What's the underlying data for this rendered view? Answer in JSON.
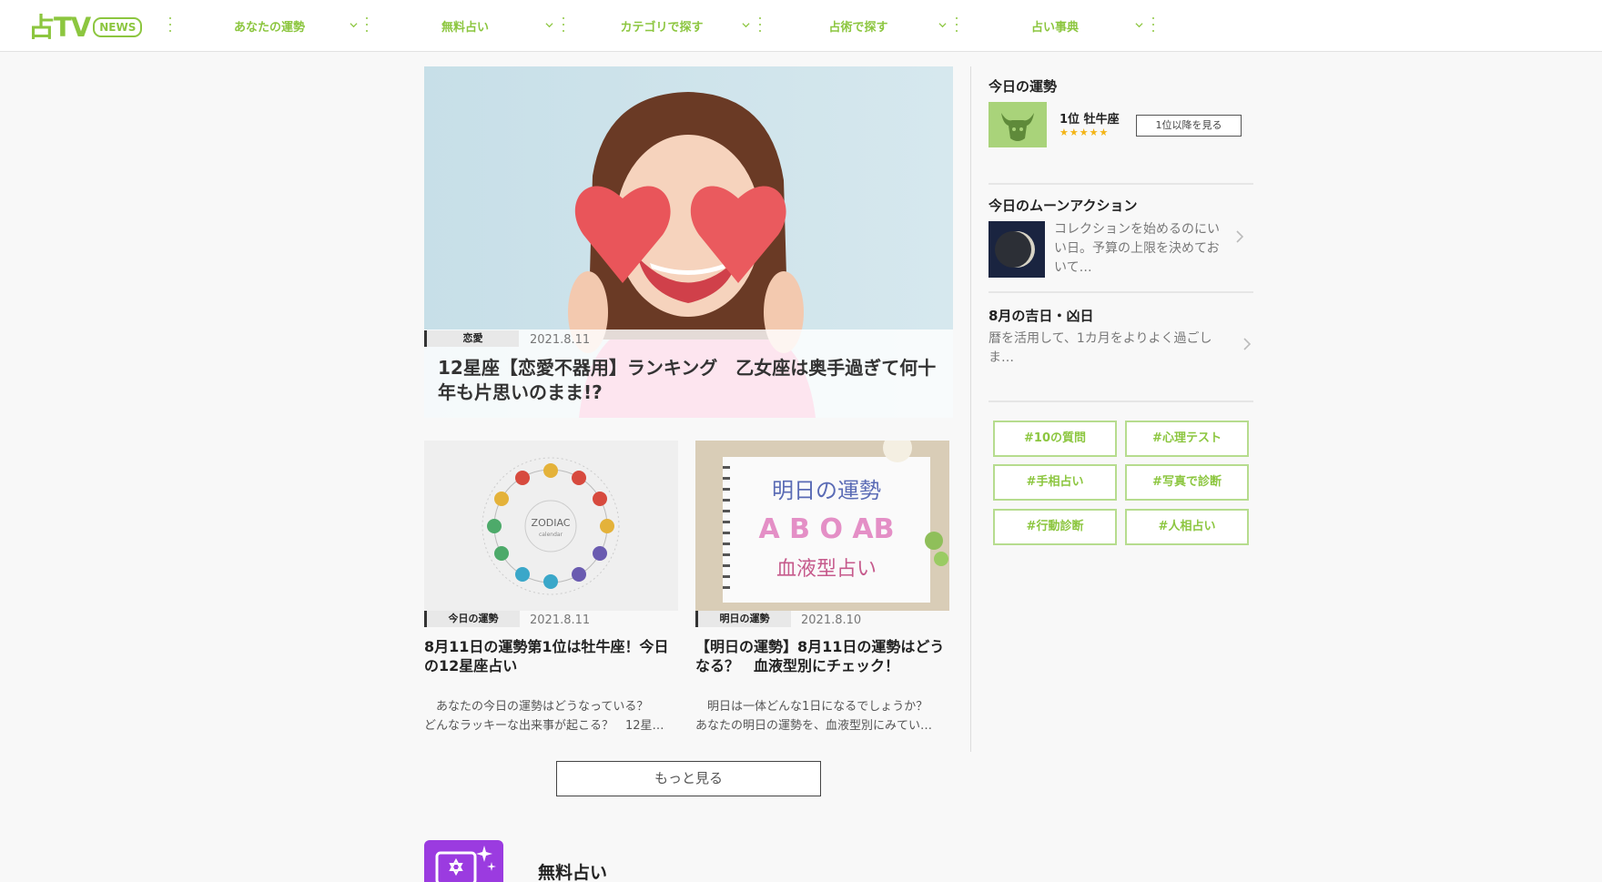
{
  "colors": {
    "brand_green": "#8cc63f",
    "star": "#f3b416",
    "free_icon": "#9b3be0"
  },
  "header": {
    "logo_mark": "占TV",
    "logo_badge": "NEWS",
    "nav": [
      {
        "label": "あなたの運勢",
        "icon": "chevron-down-icon"
      },
      {
        "label": "無料占い",
        "icon": "chevron-down-icon"
      },
      {
        "label": "カテゴリで探す",
        "icon": "chevron-down-icon"
      },
      {
        "label": "占術で探す",
        "icon": "chevron-down-icon"
      },
      {
        "label": "占い事典",
        "icon": "chevron-down-icon"
      }
    ]
  },
  "featured": {
    "category": "恋愛",
    "date": "2021.8.11",
    "title": "12星座【恋愛不器用】ランキング　乙女座は奥手過ぎて何十年も片思いのまま!?"
  },
  "cards": [
    {
      "category": "今日の運勢",
      "date": "2021.8.11",
      "title": "8月11日の運勢第1位は牡牛座！今日の12星座占い",
      "desc": "　あなたの今日の運勢はどうなっている？\nどんなラッキーな出来事が起こる？　12星…",
      "thumb_text_main": "ZODIAC",
      "thumb_text_sub": "calendar"
    },
    {
      "category": "明日の運勢",
      "date": "2021.8.10",
      "title": "【明日の運勢】8月11日の運勢はどうなる？　血液型別にチェック！",
      "desc": "　明日は一体どんな1日になるでしょうか？\nあなたの明日の運勢を、血液型別にみてい…",
      "thumb_line1": "明日の運勢",
      "thumb_line2": "A B O AB",
      "thumb_line3": "血液型占い"
    }
  ],
  "more_button": "もっと見る",
  "free_section": {
    "title": "無料占い",
    "icon": "fortune-card-icon"
  },
  "sidebar": {
    "today_fortune": {
      "heading": "今日の運勢",
      "rank": "1位 牡牛座",
      "stars": "★★★★★",
      "rating": 5,
      "button": "1位以降を見る"
    },
    "moon_action": {
      "heading": "今日のムーンアクション",
      "text": "コレクションを始めるのにいい日。予算の上限を決めておいて…"
    },
    "lucky_days": {
      "heading": "8月の吉日・凶日",
      "text": "暦を活用して、1カ月をよりよく過ごしま…"
    },
    "tags": [
      "#10の質問",
      "#心理テスト",
      "#手相占い",
      "#写真で診断",
      "#行動診断",
      "#人相占い"
    ]
  }
}
